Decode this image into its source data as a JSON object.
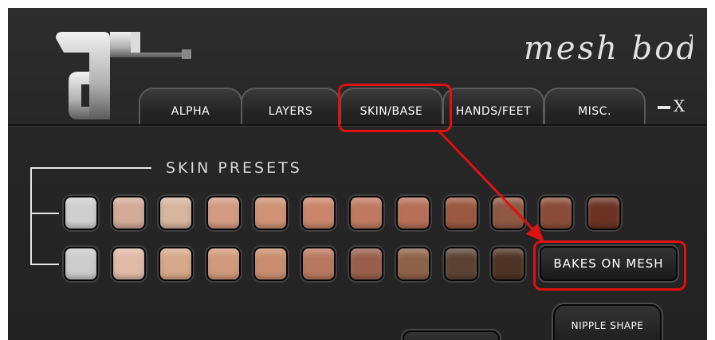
{
  "brand": {
    "script_text": "mesh body"
  },
  "tabs": [
    {
      "label": "ALPHA"
    },
    {
      "label": "LAYERS"
    },
    {
      "label": "SKIN/BASE"
    },
    {
      "label": "HANDS/FEET"
    },
    {
      "label": "MISC."
    }
  ],
  "window_controls": {
    "minimize": "minimize",
    "close": "X"
  },
  "skin_presets": {
    "title": "SKIN PRESETS",
    "row1_colors": [
      "#cfcfcf",
      "#d3ab98",
      "#d6b69e",
      "#d29b82",
      "#cf9274",
      "#c9866a",
      "#c07a61",
      "#b86f58",
      "#99583f",
      "#8e5843",
      "#8a4c38",
      "#6c3325"
    ],
    "row2_colors": [
      "#cccccc",
      "#dfbba7",
      "#d7a889",
      "#d2997b",
      "#c98e6e",
      "#b8785f",
      "#98604c",
      "#8e6249",
      "#5b4234",
      "#4e3325"
    ]
  },
  "buttons": {
    "bakes_on_mesh": "BAKES ON MESH",
    "nipple_shape": "NIPPLE SHAPE"
  },
  "accent_color": "#e21010"
}
